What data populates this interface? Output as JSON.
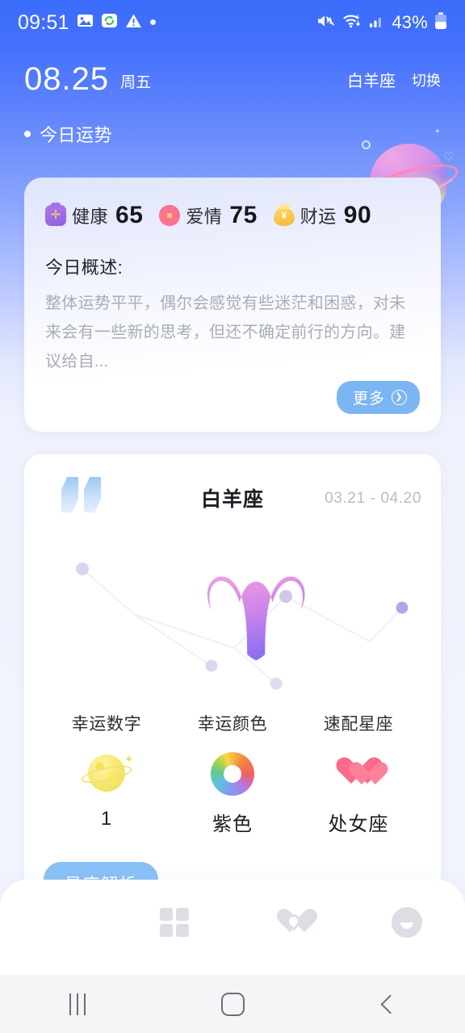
{
  "statusbar": {
    "time": "09:51",
    "battery_pct": "43%",
    "left_icons": [
      "image-icon",
      "sync-icon",
      "warning-icon",
      "dot-icon"
    ],
    "right_icons": [
      "mute-icon",
      "wifi-icon",
      "signal-icon",
      "battery-icon"
    ]
  },
  "header": {
    "date": "08.25",
    "weekday": "周五",
    "sign": "白羊座",
    "switch": "切换",
    "section_title": "今日运势"
  },
  "fortune": {
    "scores": [
      {
        "icon": "medical-kit-icon",
        "label": "健康",
        "value": "65"
      },
      {
        "icon": "flower-icon",
        "label": "爱情",
        "value": "75"
      },
      {
        "icon": "money-bag-icon",
        "label": "财运",
        "value": "90"
      }
    ],
    "summary_title": "今日概述:",
    "summary_text": "整体运势平平，偶尔会感觉有些迷茫和困惑，对未来会有一些新的思考，但还不确定前行的方向。建议给自...",
    "more_label": "更多"
  },
  "zodiac": {
    "title": "白羊座",
    "date_range": "03.21 - 04.20",
    "glyph": "aries-glyph",
    "lucky": [
      {
        "label": "幸运数字",
        "icon": "moon-planet-icon",
        "value": "1"
      },
      {
        "label": "幸运颜色",
        "icon": "color-wheel-icon",
        "value": "紫色"
      },
      {
        "label": "速配星座",
        "icon": "double-heart-icon",
        "value": "处女座"
      }
    ],
    "analyse_label": "星座解析"
  },
  "tabbar": {
    "items": [
      {
        "name": "home",
        "icon": "home-icon",
        "active": true
      },
      {
        "name": "discover",
        "icon": "grid-icon",
        "active": false
      },
      {
        "name": "match",
        "icon": "heart-icon",
        "active": false
      },
      {
        "name": "profile",
        "icon": "profile-icon",
        "active": false
      }
    ]
  },
  "navbar": {
    "items": [
      "recents-icon",
      "home-square-icon",
      "back-icon"
    ]
  },
  "colors": {
    "header_blue": "#3a6cfb",
    "accent_button": "#7cb6f2",
    "analyse_button": "#89c0f5",
    "tab_active": "#6f5cf0",
    "score_text": "#16161c",
    "muted_text": "#a9adb8"
  }
}
